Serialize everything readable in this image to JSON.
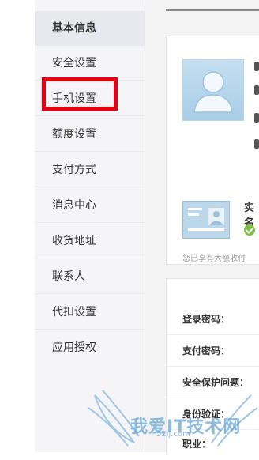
{
  "sidebar": {
    "items": [
      {
        "label": "基本信息"
      },
      {
        "label": "安全设置"
      },
      {
        "label": "手机设置"
      },
      {
        "label": "额度设置"
      },
      {
        "label": "支付方式"
      },
      {
        "label": "消息中心"
      },
      {
        "label": "收货地址"
      },
      {
        "label": "联系人"
      },
      {
        "label": "代扣设置"
      },
      {
        "label": "应用授权"
      }
    ]
  },
  "verify": {
    "title": "实名",
    "description": "您已享有大额收付"
  },
  "security": {
    "rows": [
      {
        "label": "登录密码："
      },
      {
        "label": "支付密码："
      },
      {
        "label": "安全保护问题："
      },
      {
        "label": "身份验证："
      },
      {
        "label": "职业："
      }
    ]
  },
  "watermark": {
    "text": "我爱IT技术网",
    "sub": "52ij.com"
  },
  "colors": {
    "highlight": "#e60012",
    "sidebar_bg": "#f5f5f7",
    "active_bg": "#e8e9ee",
    "check_green": "#7bc043"
  }
}
